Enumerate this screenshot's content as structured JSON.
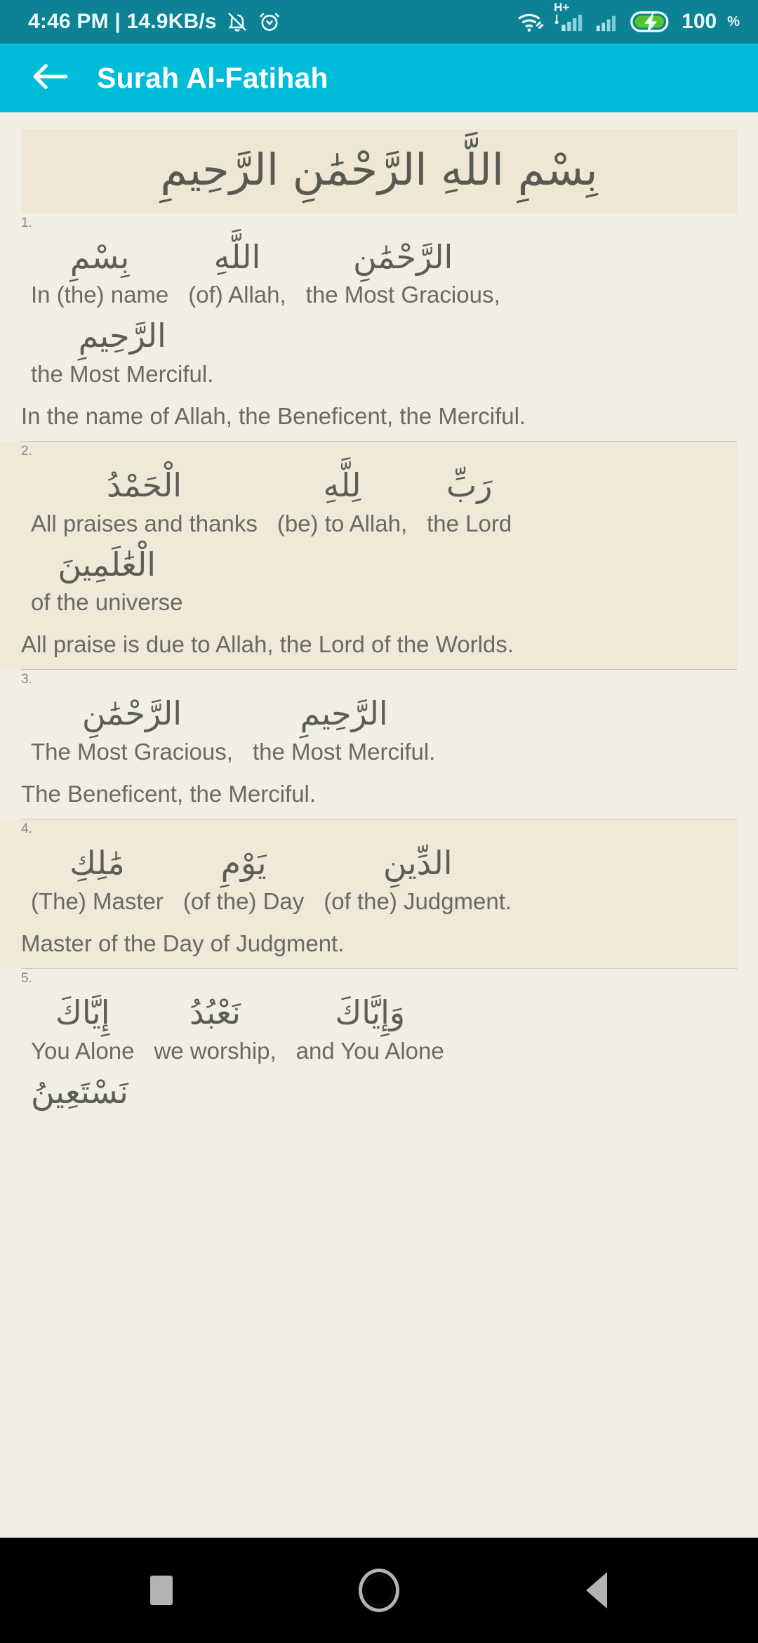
{
  "statusbar": {
    "clock": "4:46 PM | 14.9KB/s",
    "battery_percent": "100",
    "percent_symbol": "%",
    "network_type": "H+",
    "icons": [
      "bell-muted-icon",
      "alarm-clock-icon",
      "wifi-icon",
      "signal-icon",
      "signal-icon-2",
      "battery-charging-icon"
    ],
    "bg_color": "#0C8294"
  },
  "appbar": {
    "title": "Surah Al-Fatihah",
    "back_icon": "arrow-left-icon",
    "bg_color": "#00BCD9",
    "text_color": "#FFFFFF"
  },
  "content": {
    "bg_color": "#F1EEE4",
    "tint_color": "#EFE9D7",
    "bismillah_bg": "#EDE7D4",
    "text_color": "#6A6A62",
    "bismillah": "بِسْمِ اللَّهِ الرَّحْمَٰنِ الرَّحِيمِ",
    "verses": [
      {
        "number": "1.",
        "tinted": false,
        "words": [
          {
            "arabic": "بِسْمِ",
            "english": "In (the) name"
          },
          {
            "arabic": "اللَّهِ",
            "english": "(of) Allah,"
          },
          {
            "arabic": "الرَّحْمَٰنِ",
            "english": "the Most Gracious,"
          }
        ],
        "words2": [
          {
            "arabic": "الرَّحِيمِ",
            "english": "the Most Merciful."
          }
        ],
        "translation": "In the name of Allah, the Beneficent, the Merciful."
      },
      {
        "number": "2.",
        "tinted": true,
        "words": [
          {
            "arabic": "الْحَمْدُ",
            "english": "All praises and thanks"
          },
          {
            "arabic": "لِلَّهِ",
            "english": "(be) to Allah,"
          },
          {
            "arabic": "رَبِّ",
            "english": "the Lord"
          }
        ],
        "words2": [
          {
            "arabic": "الْعَٰلَمِينَ",
            "english": "of the universe"
          }
        ],
        "translation": "All praise is due to Allah, the Lord of the Worlds."
      },
      {
        "number": "3.",
        "tinted": false,
        "words": [
          {
            "arabic": "الرَّحْمَٰنِ",
            "english": "The Most Gracious,"
          },
          {
            "arabic": "الرَّحِيمِ",
            "english": "the Most Merciful."
          }
        ],
        "words2": [],
        "translation": "The Beneficent, the Merciful."
      },
      {
        "number": "4.",
        "tinted": true,
        "words": [
          {
            "arabic": "مَٰلِكِ",
            "english": "(The) Master"
          },
          {
            "arabic": "يَوْمِ",
            "english": "(of the) Day"
          },
          {
            "arabic": "الدِّينِ",
            "english": "(of the) Judgment."
          }
        ],
        "words2": [],
        "translation": "Master of the Day of Judgment."
      },
      {
        "number": "5.",
        "tinted": false,
        "words": [
          {
            "arabic": "إِيَّاكَ",
            "english": "You Alone"
          },
          {
            "arabic": "نَعْبُدُ",
            "english": "we worship,"
          },
          {
            "arabic": "وَإِيَّاكَ",
            "english": "and You Alone"
          }
        ],
        "words2": [
          {
            "arabic": "نَسْتَعِينُ",
            "english": ""
          }
        ],
        "translation": ""
      }
    ]
  },
  "navbar": {
    "bg_color": "#000000",
    "buttons": [
      {
        "name": "recents-button",
        "icon": "square-icon"
      },
      {
        "name": "home-button",
        "icon": "circle-icon"
      },
      {
        "name": "back-button",
        "icon": "triangle-left-icon"
      }
    ]
  }
}
